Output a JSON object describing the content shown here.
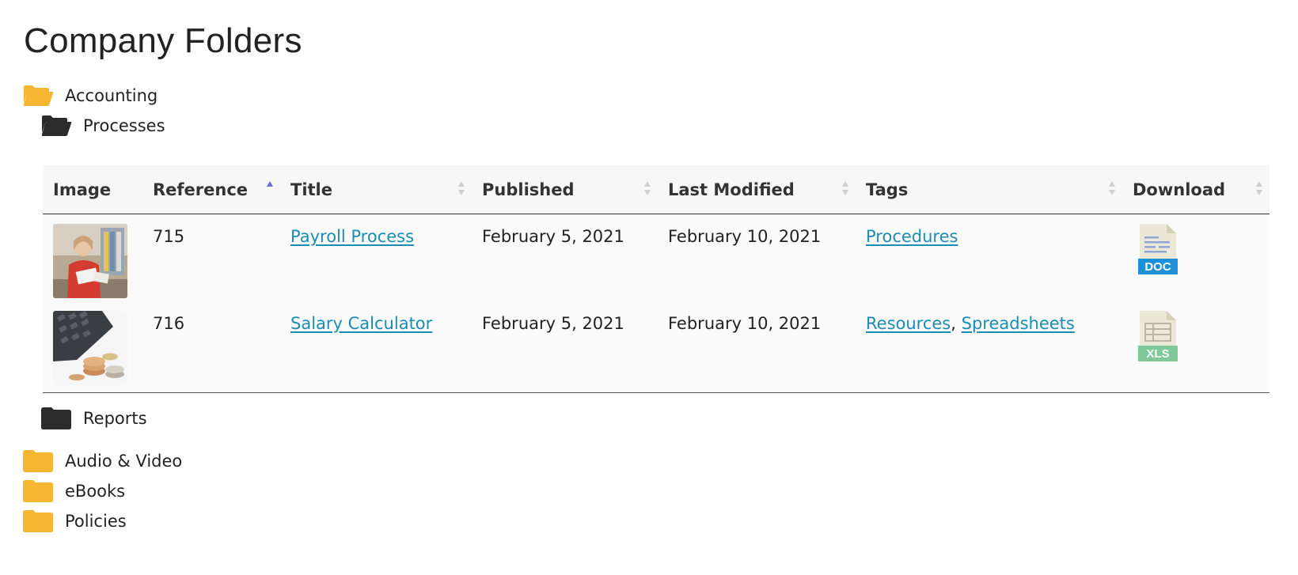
{
  "page": {
    "title": "Company Folders"
  },
  "folders": {
    "accounting": {
      "label": "Accounting",
      "state": "open",
      "color": "#f5b731"
    },
    "processes": {
      "label": "Processes",
      "state": "open",
      "color": "#2b2b2b"
    },
    "reports": {
      "label": "Reports",
      "state": "closed",
      "color": "#2b2b2b"
    },
    "audio_video": {
      "label": "Audio & Video",
      "state": "closed",
      "color": "#f5b731"
    },
    "ebooks": {
      "label": "eBooks",
      "state": "closed",
      "color": "#f5b731"
    },
    "policies": {
      "label": "Policies",
      "state": "closed",
      "color": "#f5b731"
    }
  },
  "table": {
    "columns": [
      {
        "label": "Image",
        "sortable": false
      },
      {
        "label": "Reference",
        "sortable": true,
        "sorted": "ascending"
      },
      {
        "label": "Title",
        "sortable": true
      },
      {
        "label": "Published",
        "sortable": true
      },
      {
        "label": "Last Modified",
        "sortable": true
      },
      {
        "label": "Tags",
        "sortable": true
      },
      {
        "label": "Download",
        "sortable": true
      }
    ],
    "rows": [
      {
        "image": "person-with-papers-thumbnail",
        "reference": "715",
        "title": "Payroll Process",
        "published": "February 5, 2021",
        "last_modified": "February 10, 2021",
        "tags": [
          "Procedures"
        ],
        "download": {
          "label": "DOC",
          "icon": "doc-file-icon",
          "color": "#1e90d8"
        }
      },
      {
        "image": "calculator-and-coins-thumbnail",
        "reference": "716",
        "title": "Salary Calculator",
        "published": "February 5, 2021",
        "last_modified": "February 10, 2021",
        "tags": [
          "Resources",
          "Spreadsheets"
        ],
        "tag_separator": ",",
        "download": {
          "label": "XLS",
          "icon": "xls-file-icon",
          "color": "#7ec89a"
        }
      }
    ]
  },
  "colors": {
    "link": "#1a8db5",
    "folder_yellow": "#f5b731",
    "folder_dark": "#2b2b2b",
    "sort_active": "#6b6bd6"
  }
}
